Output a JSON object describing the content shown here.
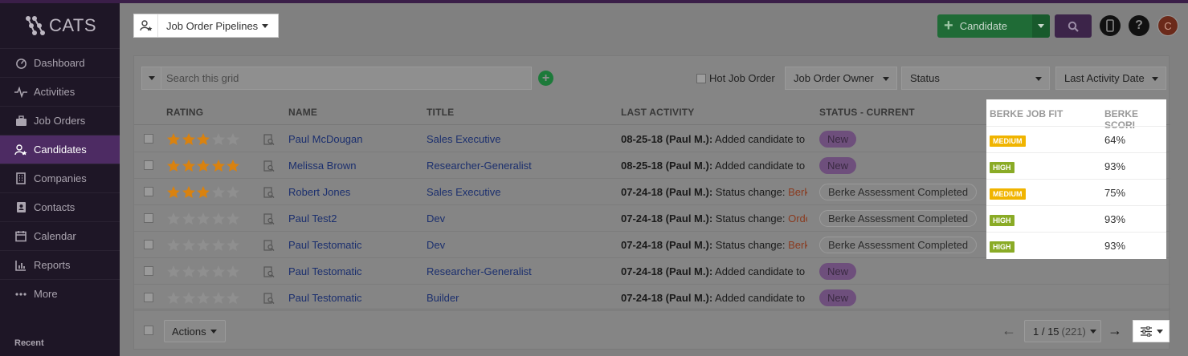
{
  "app": {
    "logo_text": "CATS"
  },
  "sidebar": {
    "items": [
      {
        "label": "Dashboard",
        "icon": "dashboard-icon"
      },
      {
        "label": "Activities",
        "icon": "activity-icon"
      },
      {
        "label": "Job Orders",
        "icon": "briefcase-icon"
      },
      {
        "label": "Candidates",
        "icon": "candidate-icon",
        "active": true
      },
      {
        "label": "Companies",
        "icon": "building-icon"
      },
      {
        "label": "Contacts",
        "icon": "contact-card-icon"
      },
      {
        "label": "Calendar",
        "icon": "calendar-icon"
      },
      {
        "label": "Reports",
        "icon": "chart-icon"
      },
      {
        "label": "More",
        "icon": "more-icon"
      }
    ],
    "recent_label": "Recent"
  },
  "header": {
    "pipeline_label": "Job Order Pipelines",
    "candidate_button": "Candidate",
    "avatar_initial": "C"
  },
  "toolbar": {
    "search_placeholder": "Search this grid",
    "hot_job_label": "Hot Job Order",
    "filters": [
      "Job Order Owner",
      "Status",
      "Last Activity Date"
    ]
  },
  "table": {
    "columns": {
      "rating": "RATING",
      "name": "NAME",
      "title": "TITLE",
      "last_activity": "LAST ACTIVITY",
      "status": "STATUS - CURRENT",
      "berke_fit": "BERKE JOB FIT",
      "berke_score": "BERKE SCORI"
    },
    "rows": [
      {
        "rating": 3,
        "name": "Paul McDougan",
        "title": "Sales Executive",
        "act_date": "08-25-18 (Paul M.):",
        "act_text": " Added candidate to",
        "act_link": "",
        "status": "New",
        "status_type": "new",
        "fit": "MEDIUM",
        "score": "64%"
      },
      {
        "rating": 5,
        "name": "Melissa Brown",
        "title": "Researcher-Generalist",
        "act_date": "08-25-18 (Paul M.):",
        "act_text": " Added candidate to",
        "act_link": "",
        "status": "New",
        "status_type": "new",
        "fit": "HIGH",
        "score": "93%"
      },
      {
        "rating": 3,
        "name": "Robert Jones",
        "title": "Sales Executive",
        "act_date": "07-24-18 (Paul M.):",
        "act_text": " Status change: ",
        "act_link": "Berke",
        "status": "Berke Assessment Completed",
        "status_type": "berke",
        "fit": "MEDIUM",
        "score": "75%"
      },
      {
        "rating": 0,
        "name": "Paul Test2",
        "title": "Dev",
        "act_date": "07-24-18 (Paul M.):",
        "act_text": " Status change: ",
        "act_link": "Orde",
        "status": "Berke Assessment Completed",
        "status_type": "berke",
        "fit": "HIGH",
        "score": "93%"
      },
      {
        "rating": 0,
        "name": "Paul Testomatic",
        "title": "Dev",
        "act_date": "07-24-18 (Paul M.):",
        "act_text": " Status change: ",
        "act_link": "Berke",
        "status": "Berke Assessment Completed",
        "status_type": "berke",
        "fit": "HIGH",
        "score": "93%"
      },
      {
        "rating": 0,
        "name": "Paul Testomatic",
        "title": "Researcher-Generalist",
        "act_date": "07-24-18 (Paul M.):",
        "act_text": " Added candidate to",
        "act_link": "",
        "status": "New",
        "status_type": "new",
        "fit": "",
        "score": ""
      },
      {
        "rating": 0,
        "name": "Paul Testomatic",
        "title": "Builder",
        "act_date": "07-24-18 (Paul M.):",
        "act_text": " Added candidate to",
        "act_link": "",
        "status": "New",
        "status_type": "new",
        "fit": "",
        "score": ""
      }
    ]
  },
  "footer": {
    "actions_label": "Actions",
    "page_label": "1 / 15",
    "total_label": "(221)"
  },
  "colors": {
    "sidebar_bg": "#1e1626",
    "active_nav": "#4d2b63",
    "star": "#d9820f",
    "green": "#1f6b36",
    "purple": "#3c2449",
    "badge_medium": "#f0b400",
    "badge_high": "#8aab26"
  }
}
